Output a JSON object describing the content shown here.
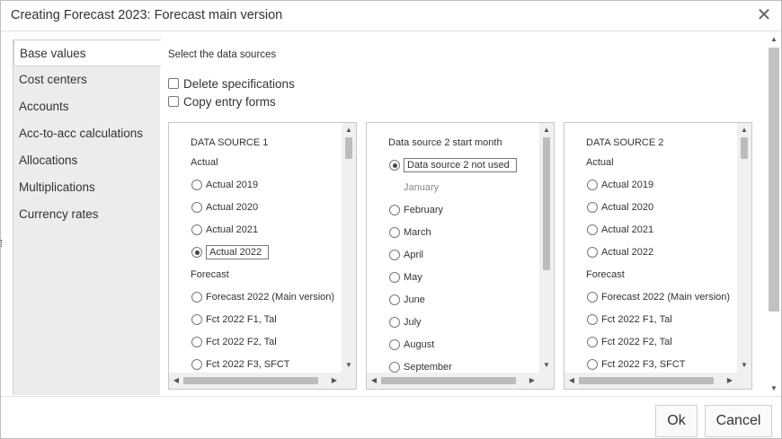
{
  "window": {
    "title": "Creating Forecast 2023: Forecast main version",
    "close_glyph": "✕"
  },
  "nav": {
    "items": [
      {
        "label": "Base values",
        "active": true
      },
      {
        "label": "Cost centers"
      },
      {
        "label": "Accounts"
      },
      {
        "label": "Acc-to-acc calculations"
      },
      {
        "label": "Allocations"
      },
      {
        "label": "Multiplications"
      },
      {
        "label": "Currency rates"
      }
    ]
  },
  "main": {
    "section_label": "Select the data sources",
    "checkboxes": [
      {
        "label": "Delete specifications",
        "checked": false
      },
      {
        "label": "Copy entry forms",
        "checked": false
      }
    ]
  },
  "source1": {
    "header": "DATA SOURCE 1",
    "group_actual": "Actual",
    "items_actual": [
      "Actual 2019",
      "Actual 2020",
      "Actual 2021",
      "Actual 2022"
    ],
    "selected": "Actual 2022",
    "group_forecast": "Forecast",
    "items_forecast": [
      "Forecast 2022 (Main version)",
      "Fct 2022 F1, Tal",
      "Fct 2022 F2, Tal",
      "Fct 2022 F3, SFCT"
    ]
  },
  "month": {
    "header": "Data source 2 start month",
    "not_used": "Data source 2 not used",
    "january": "January",
    "months": [
      "February",
      "March",
      "April",
      "May",
      "June",
      "July",
      "August",
      "September"
    ]
  },
  "source2": {
    "header": "DATA SOURCE 2",
    "group_actual": "Actual",
    "items_actual": [
      "Actual 2019",
      "Actual 2020",
      "Actual 2021",
      "Actual 2022"
    ],
    "group_forecast": "Forecast",
    "items_forecast": [
      "Forecast 2022 (Main version)",
      "Fct 2022 F1, Tal",
      "Fct 2022 F2, Tal",
      "Fct 2022 F3, SFCT"
    ]
  },
  "footer": {
    "ok_label": "Ok",
    "cancel_label": "Cancel"
  },
  "icons": {
    "close": "close-icon",
    "scroll_up": "arrow-up-icon",
    "scroll_down": "arrow-down-icon",
    "scroll_left": "arrow-left-icon",
    "scroll_right": "arrow-right-icon"
  }
}
